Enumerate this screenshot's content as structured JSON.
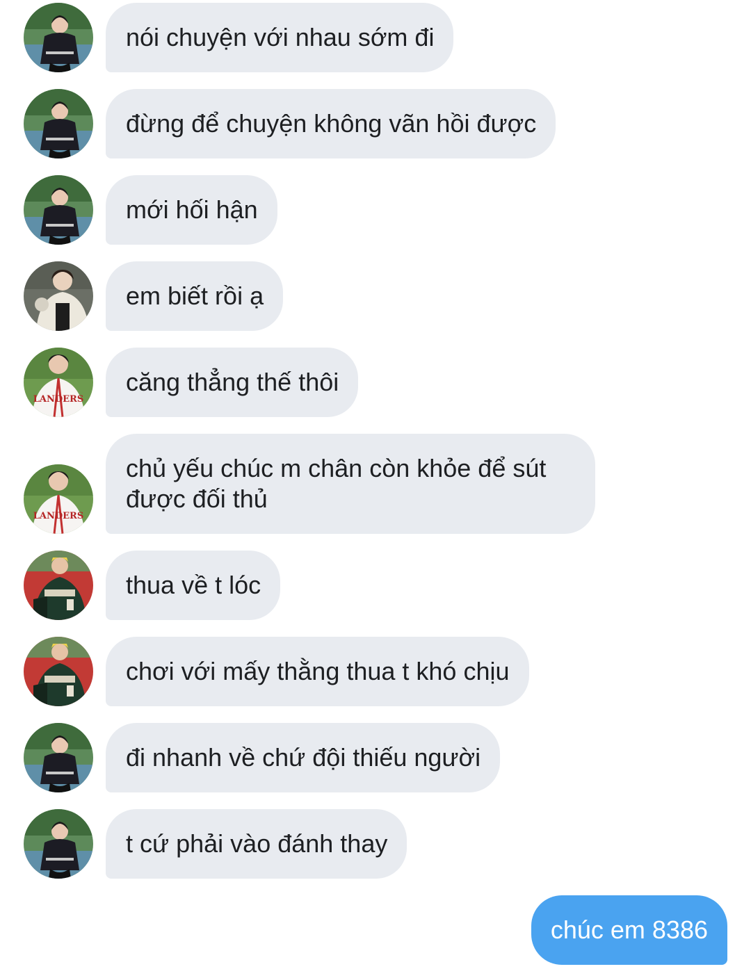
{
  "messages": [
    {
      "text": "nói chuyện với nhau sớm đi",
      "avatar": "boy-dark-jersey-avatar"
    },
    {
      "text": "đừng để chuyện không vãn hồi được",
      "avatar": "boy-dark-jersey-avatar"
    },
    {
      "text": "mới hối hận",
      "avatar": "boy-dark-jersey-avatar"
    },
    {
      "text": "em biết rồi ạ",
      "avatar": "boy-cream-jacket-avatar"
    },
    {
      "text": "căng thẳng thế thôi",
      "avatar": "boy-landers-jersey-avatar"
    },
    {
      "text": "chủ yếu chúc m chân còn khỏe để sút được đối thủ",
      "avatar": "boy-landers-jersey-avatar"
    },
    {
      "text": "thua về t lóc",
      "avatar": "boy-green-jersey-avatar"
    },
    {
      "text": "chơi với mấy thằng thua t khó chịu",
      "avatar": "boy-green-jersey-avatar"
    },
    {
      "text": "đi nhanh về chứ đội thiếu người",
      "avatar": "boy-dark-jersey-avatar"
    },
    {
      "text": "t cứ phải vào đánh thay",
      "avatar": "boy-dark-jersey-avatar"
    }
  ],
  "outgoing": {
    "text": "chúc em 8386"
  },
  "colors": {
    "incoming_bubble": "#e8ebf0",
    "outgoing_bubble": "#4aa3f0",
    "text": "#1d1f22"
  }
}
